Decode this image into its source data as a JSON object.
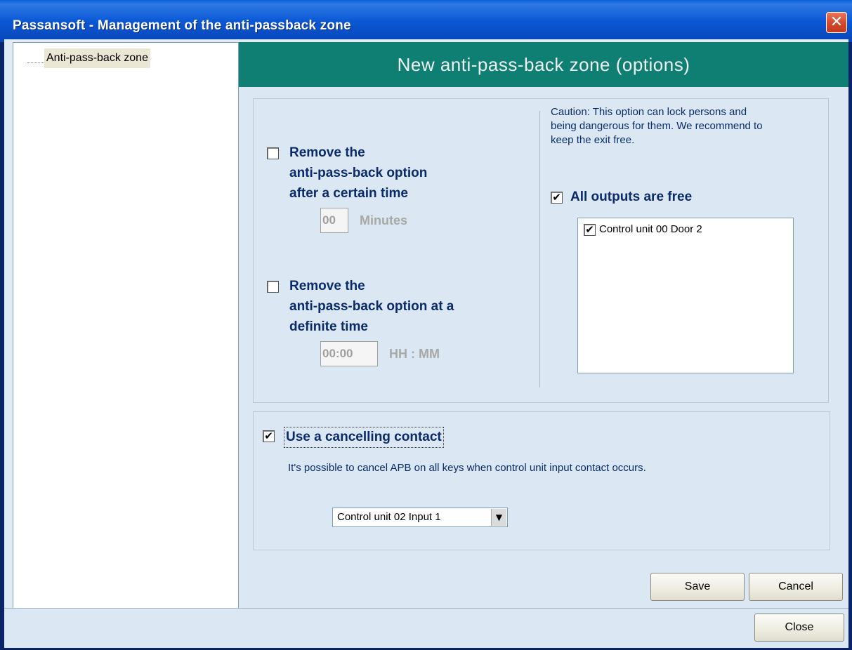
{
  "window": {
    "title": "Passansoft - Management of the anti-passback zone",
    "close_glyph": "✕"
  },
  "tree": {
    "items": [
      {
        "label": "Anti-pass-back zone"
      }
    ]
  },
  "panel": {
    "header": "New anti-pass-back zone (options)",
    "remove_after_time": {
      "checked": false,
      "label_line1": "Remove the",
      "label_line2": "anti-pass-back option",
      "label_line3": "after a certain time",
      "value": "00",
      "unit": "Minutes"
    },
    "remove_at_time": {
      "checked": false,
      "label_line1": "Remove the",
      "label_line2": "anti-pass-back option at a",
      "label_line3": "definite time",
      "value": "00:00",
      "unit": "HH : MM"
    },
    "caution": {
      "line1": "Caution: This option can lock persons and",
      "line2": "being dangerous for them. We recommend to",
      "line3": "keep the exit free."
    },
    "all_outputs_free": {
      "checked": true,
      "label": "All outputs are free"
    },
    "outputs_list": [
      {
        "label": "Control unit 00 Door 2",
        "checked": true
      }
    ],
    "cancelling_contact": {
      "checked": true,
      "label": "Use a cancelling contact",
      "description": "It's possible to cancel APB on all keys when control unit input contact occurs.",
      "selected_input": "Control unit 02 Input 1"
    }
  },
  "buttons": {
    "save": "Save",
    "cancel": "Cancel",
    "close": "Close"
  },
  "icons": {
    "checkmark": "✔",
    "dropdown_arrow": "▼"
  },
  "colors": {
    "title_bar": "#0b58d5",
    "panel_header": "#0f7f74",
    "label_text": "#0a2a6a"
  }
}
